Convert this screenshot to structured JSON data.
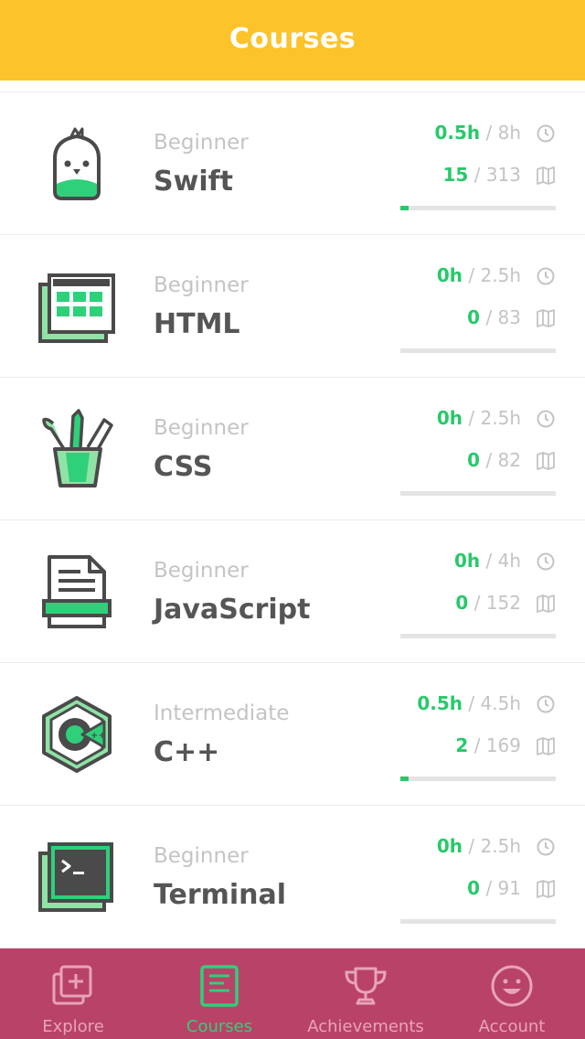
{
  "header": {
    "title": "Courses"
  },
  "colors": {
    "header_bg": "#fcc42a",
    "accent_green": "#27c96a",
    "tabbar_bg": "#b94268",
    "tab_inactive": "#e7a4b8"
  },
  "courses": [
    {
      "icon": "swift-bird-icon",
      "level": "Beginner",
      "name": "Swift",
      "time_done": "0.5h",
      "time_total": "8h",
      "lessons_done": "15",
      "lessons_total": "313",
      "progress_percent": 5
    },
    {
      "icon": "html-layout-icon",
      "level": "Beginner",
      "name": "HTML",
      "time_done": "0h",
      "time_total": "2.5h",
      "lessons_done": "0",
      "lessons_total": "83",
      "progress_percent": 0
    },
    {
      "icon": "css-brush-cup-icon",
      "level": "Beginner",
      "name": "CSS",
      "time_done": "0h",
      "time_total": "2.5h",
      "lessons_done": "0",
      "lessons_total": "82",
      "progress_percent": 0
    },
    {
      "icon": "javascript-document-icon",
      "level": "Beginner",
      "name": "JavaScript",
      "time_done": "0h",
      "time_total": "4h",
      "lessons_done": "0",
      "lessons_total": "152",
      "progress_percent": 0
    },
    {
      "icon": "cpp-hexagon-icon",
      "level": "Intermediate",
      "name": "C++",
      "time_done": "0.5h",
      "time_total": "4.5h",
      "lessons_done": "2",
      "lessons_total": "169",
      "progress_percent": 5
    },
    {
      "icon": "terminal-window-icon",
      "level": "Beginner",
      "name": "Terminal",
      "time_done": "0h",
      "time_total": "2.5h",
      "lessons_done": "0",
      "lessons_total": "91",
      "progress_percent": 0
    }
  ],
  "stats": {
    "separator": "/"
  },
  "tabbar": {
    "active": "Courses",
    "tabs": [
      {
        "label": "Explore",
        "icon": "explore-add-icon"
      },
      {
        "label": "Courses",
        "icon": "courses-notes-icon"
      },
      {
        "label": "Achievements",
        "icon": "trophy-icon"
      },
      {
        "label": "Account",
        "icon": "smiley-face-icon"
      }
    ]
  }
}
